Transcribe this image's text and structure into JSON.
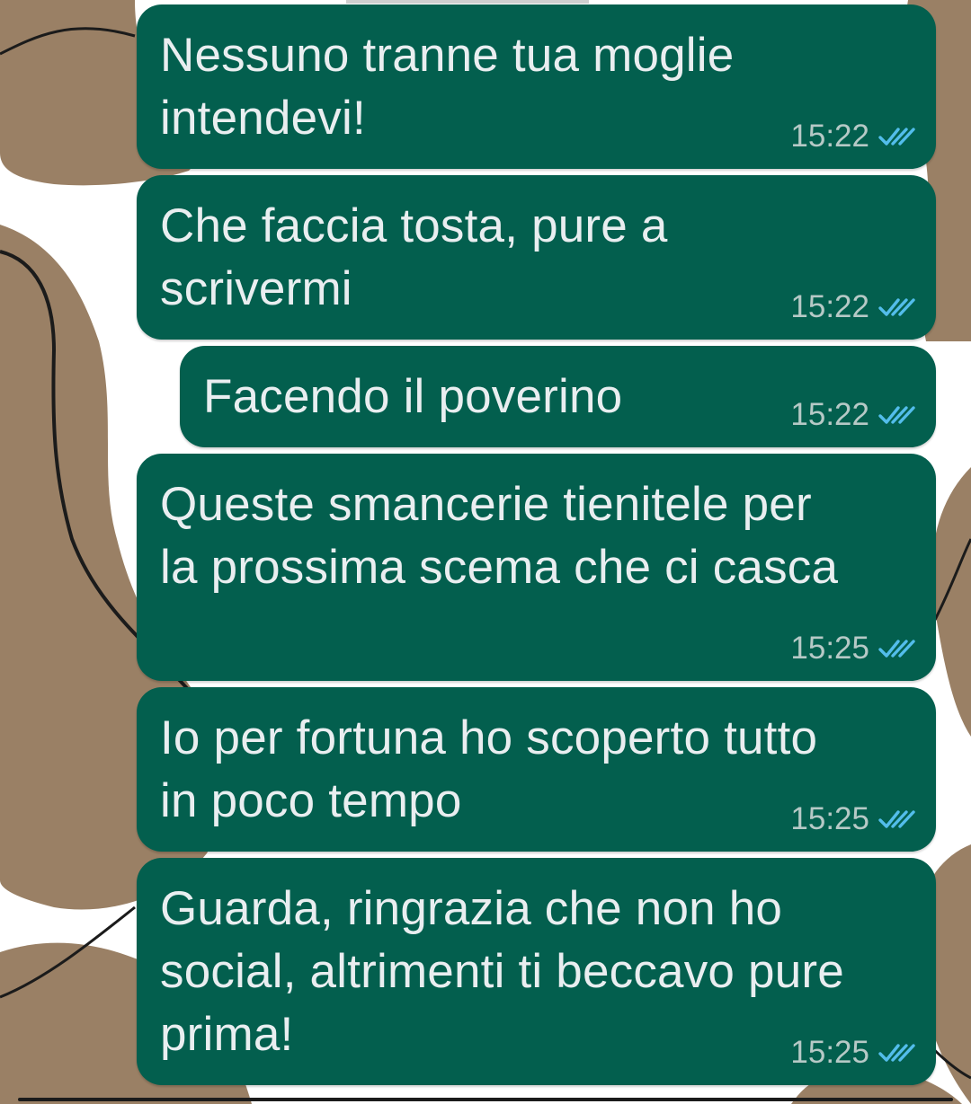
{
  "theme": {
    "bubble_color": "#035f4e",
    "text_color": "#e9eef0",
    "time_color": "#b6c9c6",
    "read_tick_color": "#53bdeb",
    "wallpaper_brown": "#9a8065",
    "wallpaper_white": "#ffffff"
  },
  "messages": [
    {
      "text": "Nessuno tranne tua moglie\nintendevi!",
      "time": "15:22",
      "status": "read"
    },
    {
      "text": "Che faccia tosta, pure a\nscrivermi",
      "time": "15:22",
      "status": "read"
    },
    {
      "text": "Facendo il poverino",
      "time": "15:22",
      "status": "read"
    },
    {
      "text": "Queste smancerie tienitele per\nla prossima scema che ci casca",
      "time": "15:25",
      "status": "read"
    },
    {
      "text": "Io per fortuna ho scoperto tutto\nin poco tempo",
      "time": "15:25",
      "status": "read"
    },
    {
      "text": "Guarda, ringrazia che non ho\nsocial, altrimenti ti beccavo pure\nprima!",
      "time": "15:25",
      "status": "read"
    }
  ],
  "icons": {
    "status_icon": "double-check-icon"
  }
}
